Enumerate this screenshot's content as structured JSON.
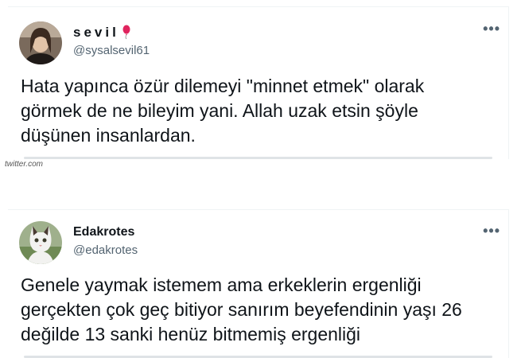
{
  "tweets": [
    {
      "display_name": "sevil",
      "handle": "@sysalsevil61",
      "more": "•••",
      "text": "Hata yapınca özür dilemeyi \"minnet etmek\" olarak\ngörmek de ne bileyim yani. Allah uzak etsin şöyle\ndüşünen insanlardan."
    },
    {
      "display_name": "Edakrotes",
      "handle": "@edakrotes",
      "more": "•••",
      "text": "Genele yaymak istemem ama erkeklerin ergenliği\ngerçekten çok geç bitiyor sanırım beyefendinin yaşı 26\ndeğilde 13 sanki henüz bitmemiş ergenliği"
    }
  ],
  "watermark": "twitter.com",
  "colors": {
    "text": "#0f1419",
    "secondary": "#536471",
    "balloon": "#e0245e"
  }
}
